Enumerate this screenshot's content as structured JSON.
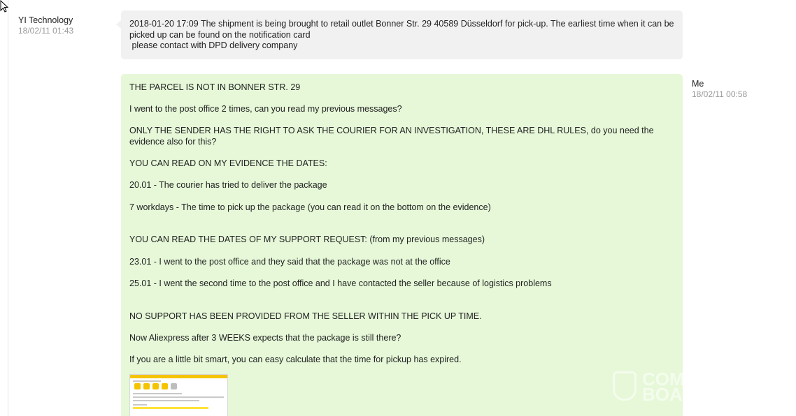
{
  "incoming": {
    "sender_name": "YI Technology",
    "sender_time": "18/02/11 01:43",
    "text": "2018-01-20 17:09 The shipment is being brought to retail outlet Bonner Str. 29 40589 Düsseldorf for pick-up. The earliest time when it can be picked up can be found on the notification card\n please contact with DPD delivery company"
  },
  "outgoing": {
    "sender_name": "Me",
    "sender_time": "18/02/11 00:58",
    "lines": [
      "THE PARCEL IS NOT IN BONNER STR. 29",
      "I went to the post office 2 times, can you read my previous messages?",
      "ONLY THE SENDER HAS THE RIGHT TO ASK THE COURIER FOR AN INVESTIGATION, THESE ARE DHL RULES, do you need the evidence also for this?",
      "YOU CAN READ ON MY EVIDENCE THE DATES:",
      "20.01 - The courier has tried to deliver the package",
      "7 workdays - The time to pick up the package (you can read it on the bottom on the evidence)",
      "YOU CAN READ THE DATES OF MY SUPPORT REQUEST: (from my previous messages)",
      "23.01 - I went to the post office and they said that the package was not at the office",
      "25.01 - I went the second time to the post office and  I have contacted the seller because of logistics problems",
      "NO SUPPORT HAS BEEN PROVIDED FROM THE SELLER WITHIN THE PICK UP TIME.",
      "Now Aliexpress after 3 WEEKS expects that the package is still there?",
      "If you are a little bit smart, you can easy calculate that the time for pickup has expired."
    ]
  },
  "watermark": {
    "line1": "COM",
    "line2": "BOA"
  },
  "colors": {
    "incoming_bubble": "#f1f1f1",
    "outgoing_bubble": "#e6f8d8",
    "timestamp": "#999999"
  }
}
